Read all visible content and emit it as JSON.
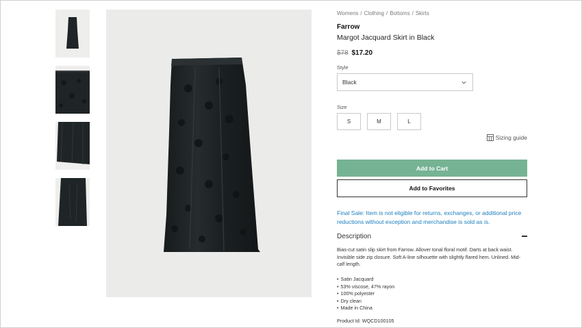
{
  "breadcrumb": [
    "Womens",
    "Clothing",
    "Bottoms",
    "Skirts"
  ],
  "product": {
    "brand": "Farrow",
    "title": "Margot Jacquard Skirt in Black",
    "price_old": "$78",
    "price_new": "$17.20"
  },
  "style": {
    "label": "Style",
    "selected": "Black"
  },
  "size": {
    "label": "Size",
    "options": [
      "S",
      "M",
      "L"
    ]
  },
  "sizing_guide": "Sizing guide",
  "buttons": {
    "add_to_cart": "Add to Cart",
    "add_to_favorites": "Add to Favorites"
  },
  "final_sale": "Final Sale: Item is not eligible for returns, exchanges, or additional price reductions without exception and merchandise is sold as is.",
  "description": {
    "heading": "Description",
    "text": "Bias-cut satin slip skirt from Farrow. Allover tonal floral motif. Darts at back waist. Invisible side zip closure. Soft A-line silhouette with slightly flared hem. Unlined. Mid-calf length.",
    "bullets": [
      "Satin Jacquard",
      "53% viscose, 47% rayon",
      "100% polyester",
      "Dry clean",
      "Made in China"
    ],
    "product_id": "Product Id: WQCD100105"
  },
  "colors": {
    "cart_green": "#76b394",
    "final_sale_blue": "#1d7fbf",
    "skirt": "#1f2426"
  }
}
